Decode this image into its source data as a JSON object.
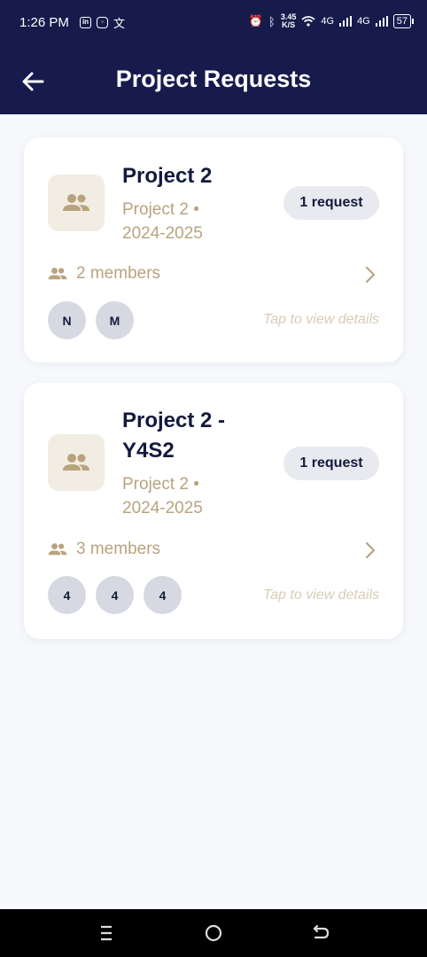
{
  "status_bar": {
    "time": "1:26 PM",
    "speed_value": "3.45",
    "speed_unit": "K/S",
    "net1": "4G",
    "net2": "4G",
    "battery": "57"
  },
  "app_bar": {
    "title": "Project Requests",
    "back_icon": "arrow-left-icon"
  },
  "projects": [
    {
      "name": "Project 2",
      "subtitle": "Project 2 • 2024-2025",
      "badge": "1 request",
      "members_label": "2 members",
      "avatars": [
        "N",
        "M"
      ],
      "hint": "Tap to view details"
    },
    {
      "name": "Project 2 - Y4S2",
      "subtitle": "Project 2 • 2024-2025",
      "badge": "1 request",
      "members_label": "3 members",
      "avatars": [
        "4",
        "4",
        "4"
      ],
      "hint": "Tap to view details"
    }
  ],
  "colors": {
    "header_bg": "#161b4c",
    "page_bg": "#f6f8fc",
    "accent_gold": "#b9a37f",
    "title_text": "#121a3d",
    "badge_bg": "#e8eaef"
  }
}
